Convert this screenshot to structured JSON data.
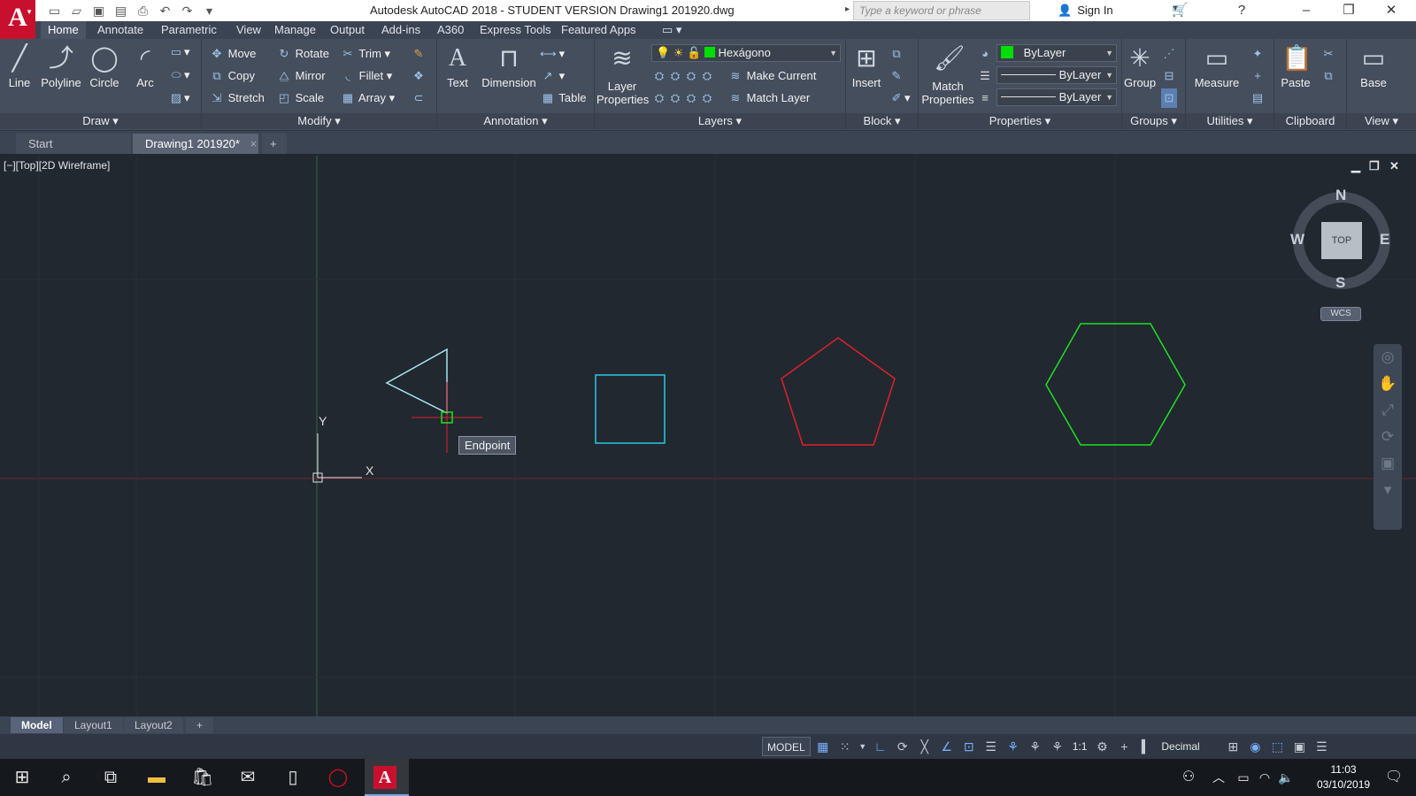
{
  "window": {
    "title": "Autodesk AutoCAD 2018 - STUDENT VERSION    Drawing1 201920.dwg",
    "search_placeholder": "Type a keyword or phrase",
    "sign_in": "Sign In",
    "app_logo": "A"
  },
  "ribbon": {
    "tabs": [
      "Home",
      "Annotate",
      "Parametric",
      "View",
      "Manage",
      "Output",
      "Add-ins",
      "A360",
      "Express Tools",
      "Featured Apps"
    ],
    "active_tab": "Home",
    "draw": {
      "title": "Draw",
      "line": "Line",
      "polyline": "Polyline",
      "circle": "Circle",
      "arc": "Arc"
    },
    "modify": {
      "title": "Modify",
      "move": "Move",
      "rotate": "Rotate",
      "trim": "Trim",
      "copy": "Copy",
      "mirror": "Mirror",
      "fillet": "Fillet",
      "stretch": "Stretch",
      "scale": "Scale",
      "array": "Array"
    },
    "annotation": {
      "title": "Annotation",
      "text": "Text",
      "dimension": "Dimension",
      "table": "Table"
    },
    "layers": {
      "title": "Layers",
      "layer_properties_1": "Layer",
      "layer_properties_2": "Properties",
      "current_layer": "Hexágono",
      "current_layer_color": "#00e000",
      "make_current": "Make Current",
      "match_layer": "Match Layer"
    },
    "block": {
      "title": "Block",
      "insert": "Insert"
    },
    "properties": {
      "title": "Properties",
      "match_1": "Match",
      "match_2": "Properties",
      "color": "ByLayer",
      "linetype": "ByLayer",
      "lineweight": "ByLayer",
      "color_swatch": "#00e000"
    },
    "groups": {
      "title": "Groups",
      "group": "Group"
    },
    "utilities": {
      "title": "Utilities",
      "measure": "Measure"
    },
    "clipboard": {
      "title": "Clipboard",
      "paste": "Paste"
    },
    "view": {
      "title": "View",
      "base": "Base"
    }
  },
  "doc_tabs": {
    "start": "Start",
    "drawing": "Drawing1 201920*",
    "close": "×",
    "add": "+"
  },
  "viewport": {
    "label": "[−][Top][2D Wireframe]",
    "tooltip": "Endpoint",
    "viewcube_face": "TOP",
    "compass": {
      "n": "N",
      "s": "S",
      "e": "E",
      "w": "W"
    },
    "wcs": "WCS",
    "ucs_x": "X",
    "ucs_y": "Y",
    "shape_colors": {
      "triangle": "#a8e6f0",
      "square": "#28c8e0",
      "pentagon": "#e0202a",
      "hexagon": "#20e020"
    }
  },
  "layout_tabs": {
    "model": "Model",
    "layout1": "Layout1",
    "layout2": "Layout2",
    "add": "+"
  },
  "status": {
    "model": "MODEL",
    "scale": "1:1",
    "units": "Decimal"
  },
  "taskbar": {
    "time": "11:03",
    "date": "03/10/2019"
  }
}
